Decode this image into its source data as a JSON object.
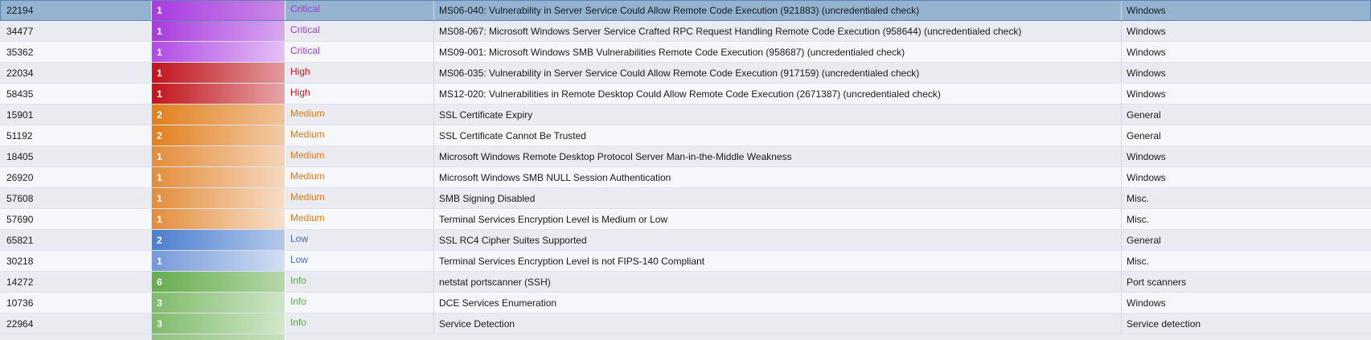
{
  "colors": {
    "critical": "#a23ad3",
    "high": "#c0161e",
    "medium": "#e07b1c",
    "low": "#3e6fbf",
    "info": "#5aa844"
  },
  "rows": [
    {
      "id": "22194",
      "count": "1",
      "severity": "Critical",
      "name": "MS06-040: Vulnerability in Server Service Could Allow Remote Code Execution (921883) (uncredentialed check)",
      "family": "Windows",
      "bar_from": "#a93be0",
      "bar_to": "#c98ae6",
      "selected": true
    },
    {
      "id": "34477",
      "count": "1",
      "severity": "Critical",
      "name": "MS08-067: Microsoft Windows Server Service Crafted RPC Request Handling Remote Code Execution (958644) (uncredentialed check)",
      "family": "Windows",
      "bar_from": "#a93be0",
      "bar_to": "#d9a7f0"
    },
    {
      "id": "35362",
      "count": "1",
      "severity": "Critical",
      "name": "MS09-001: Microsoft Windows SMB Vulnerabilities Remote Code Execution (958687) (uncredentialed check)",
      "family": "Windows",
      "bar_from": "#b04ae4",
      "bar_to": "#e4bff5"
    },
    {
      "id": "22034",
      "count": "1",
      "severity": "High",
      "name": "MS06-035: Vulnerability in Server Service Could Allow Remote Code Execution (917159) (uncredentialed check)",
      "family": "Windows",
      "bar_from": "#c1141c",
      "bar_to": "#e29a9d"
    },
    {
      "id": "58435",
      "count": "1",
      "severity": "High",
      "name": "MS12-020: Vulnerabilities in Remote Desktop Could Allow Remote Code Execution (2671387) (uncredentialed check)",
      "family": "Windows",
      "bar_from": "#c1141c",
      "bar_to": "#e6a5a8"
    },
    {
      "id": "15901",
      "count": "2",
      "severity": "Medium",
      "name": "SSL Certificate Expiry",
      "family": "General",
      "bar_from": "#e1801d",
      "bar_to": "#f1c39a"
    },
    {
      "id": "51192",
      "count": "2",
      "severity": "Medium",
      "name": "SSL Certificate Cannot Be Trusted",
      "family": "General",
      "bar_from": "#e1801d",
      "bar_to": "#f3caa6"
    },
    {
      "id": "18405",
      "count": "1",
      "severity": "Medium",
      "name": "Microsoft Windows Remote Desktop Protocol Server Man-in-the-Middle Weakness",
      "family": "Windows",
      "bar_from": "#e38d3a",
      "bar_to": "#f5d3b6"
    },
    {
      "id": "26920",
      "count": "1",
      "severity": "Medium",
      "name": "Microsoft Windows SMB NULL Session Authentication",
      "family": "Windows",
      "bar_from": "#e38d3a",
      "bar_to": "#f6d8bf"
    },
    {
      "id": "57608",
      "count": "1",
      "severity": "Medium",
      "name": "SMB Signing Disabled",
      "family": "Misc.",
      "bar_from": "#e38d3a",
      "bar_to": "#f7dcc6"
    },
    {
      "id": "57690",
      "count": "1",
      "severity": "Medium",
      "name": "Terminal Services Encryption Level is Medium or Low",
      "family": "Misc.",
      "bar_from": "#e38d3a",
      "bar_to": "#f8e0cc"
    },
    {
      "id": "65821",
      "count": "2",
      "severity": "Low",
      "name": "SSL RC4 Cipher Suites Supported",
      "family": "General",
      "bar_from": "#4a7ed0",
      "bar_to": "#b4c9ea"
    },
    {
      "id": "30218",
      "count": "1",
      "severity": "Low",
      "name": "Terminal Services Encryption Level is not FIPS-140 Compliant",
      "family": "Misc.",
      "bar_from": "#7499d9",
      "bar_to": "#d1def3"
    },
    {
      "id": "14272",
      "count": "6",
      "severity": "Info",
      "name": "netstat portscanner (SSH)",
      "family": "Port scanners",
      "bar_from": "#64ad4e",
      "bar_to": "#b6d7a9"
    },
    {
      "id": "10736",
      "count": "3",
      "severity": "Info",
      "name": "DCE Services Enumeration",
      "family": "Windows",
      "bar_from": "#7dbb69",
      "bar_to": "#cfe5c6"
    },
    {
      "id": "22964",
      "count": "3",
      "severity": "Info",
      "name": "Service Detection",
      "family": "Service detection",
      "bar_from": "#7dbb69",
      "bar_to": "#d3e7ca"
    }
  ]
}
